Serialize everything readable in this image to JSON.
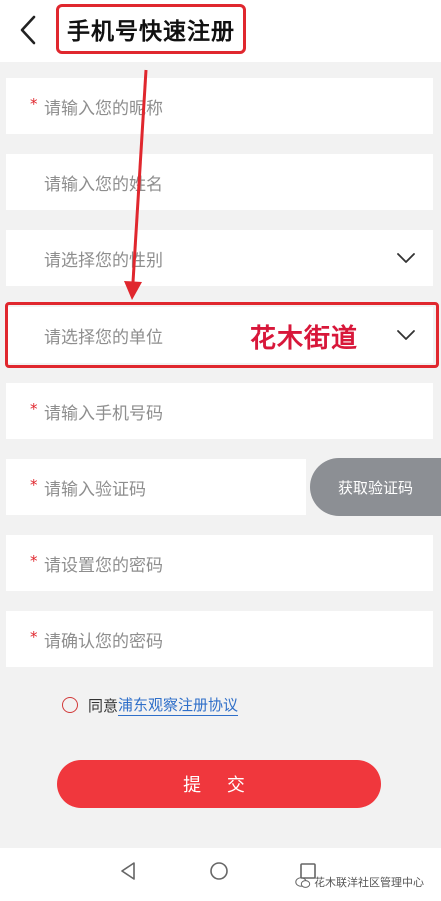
{
  "header": {
    "title": "手机号快速注册",
    "back_icon": "chevron-left-icon"
  },
  "form": {
    "required_mark": "*",
    "nickname_placeholder": "请输入您的昵称",
    "name_placeholder": "请输入您的姓名",
    "gender_placeholder": "请选择您的性别",
    "unit_placeholder": "请选择您的单位",
    "unit_value": "花木街道",
    "phone_placeholder": "请输入手机号码",
    "code_placeholder": "请输入验证码",
    "get_code_label": "获取验证码",
    "password_placeholder": "请设置您的密码",
    "confirm_placeholder": "请确认您的密码"
  },
  "agreement": {
    "prefix": "同意",
    "link": "浦东观察注册协议"
  },
  "submit_label": "提 交",
  "watermark": "花木联洋社区管理中心",
  "colors": {
    "accent": "#e0272e",
    "submit": "#f0373d",
    "link": "#2f6fc9",
    "code_button": "#8c8f94"
  }
}
